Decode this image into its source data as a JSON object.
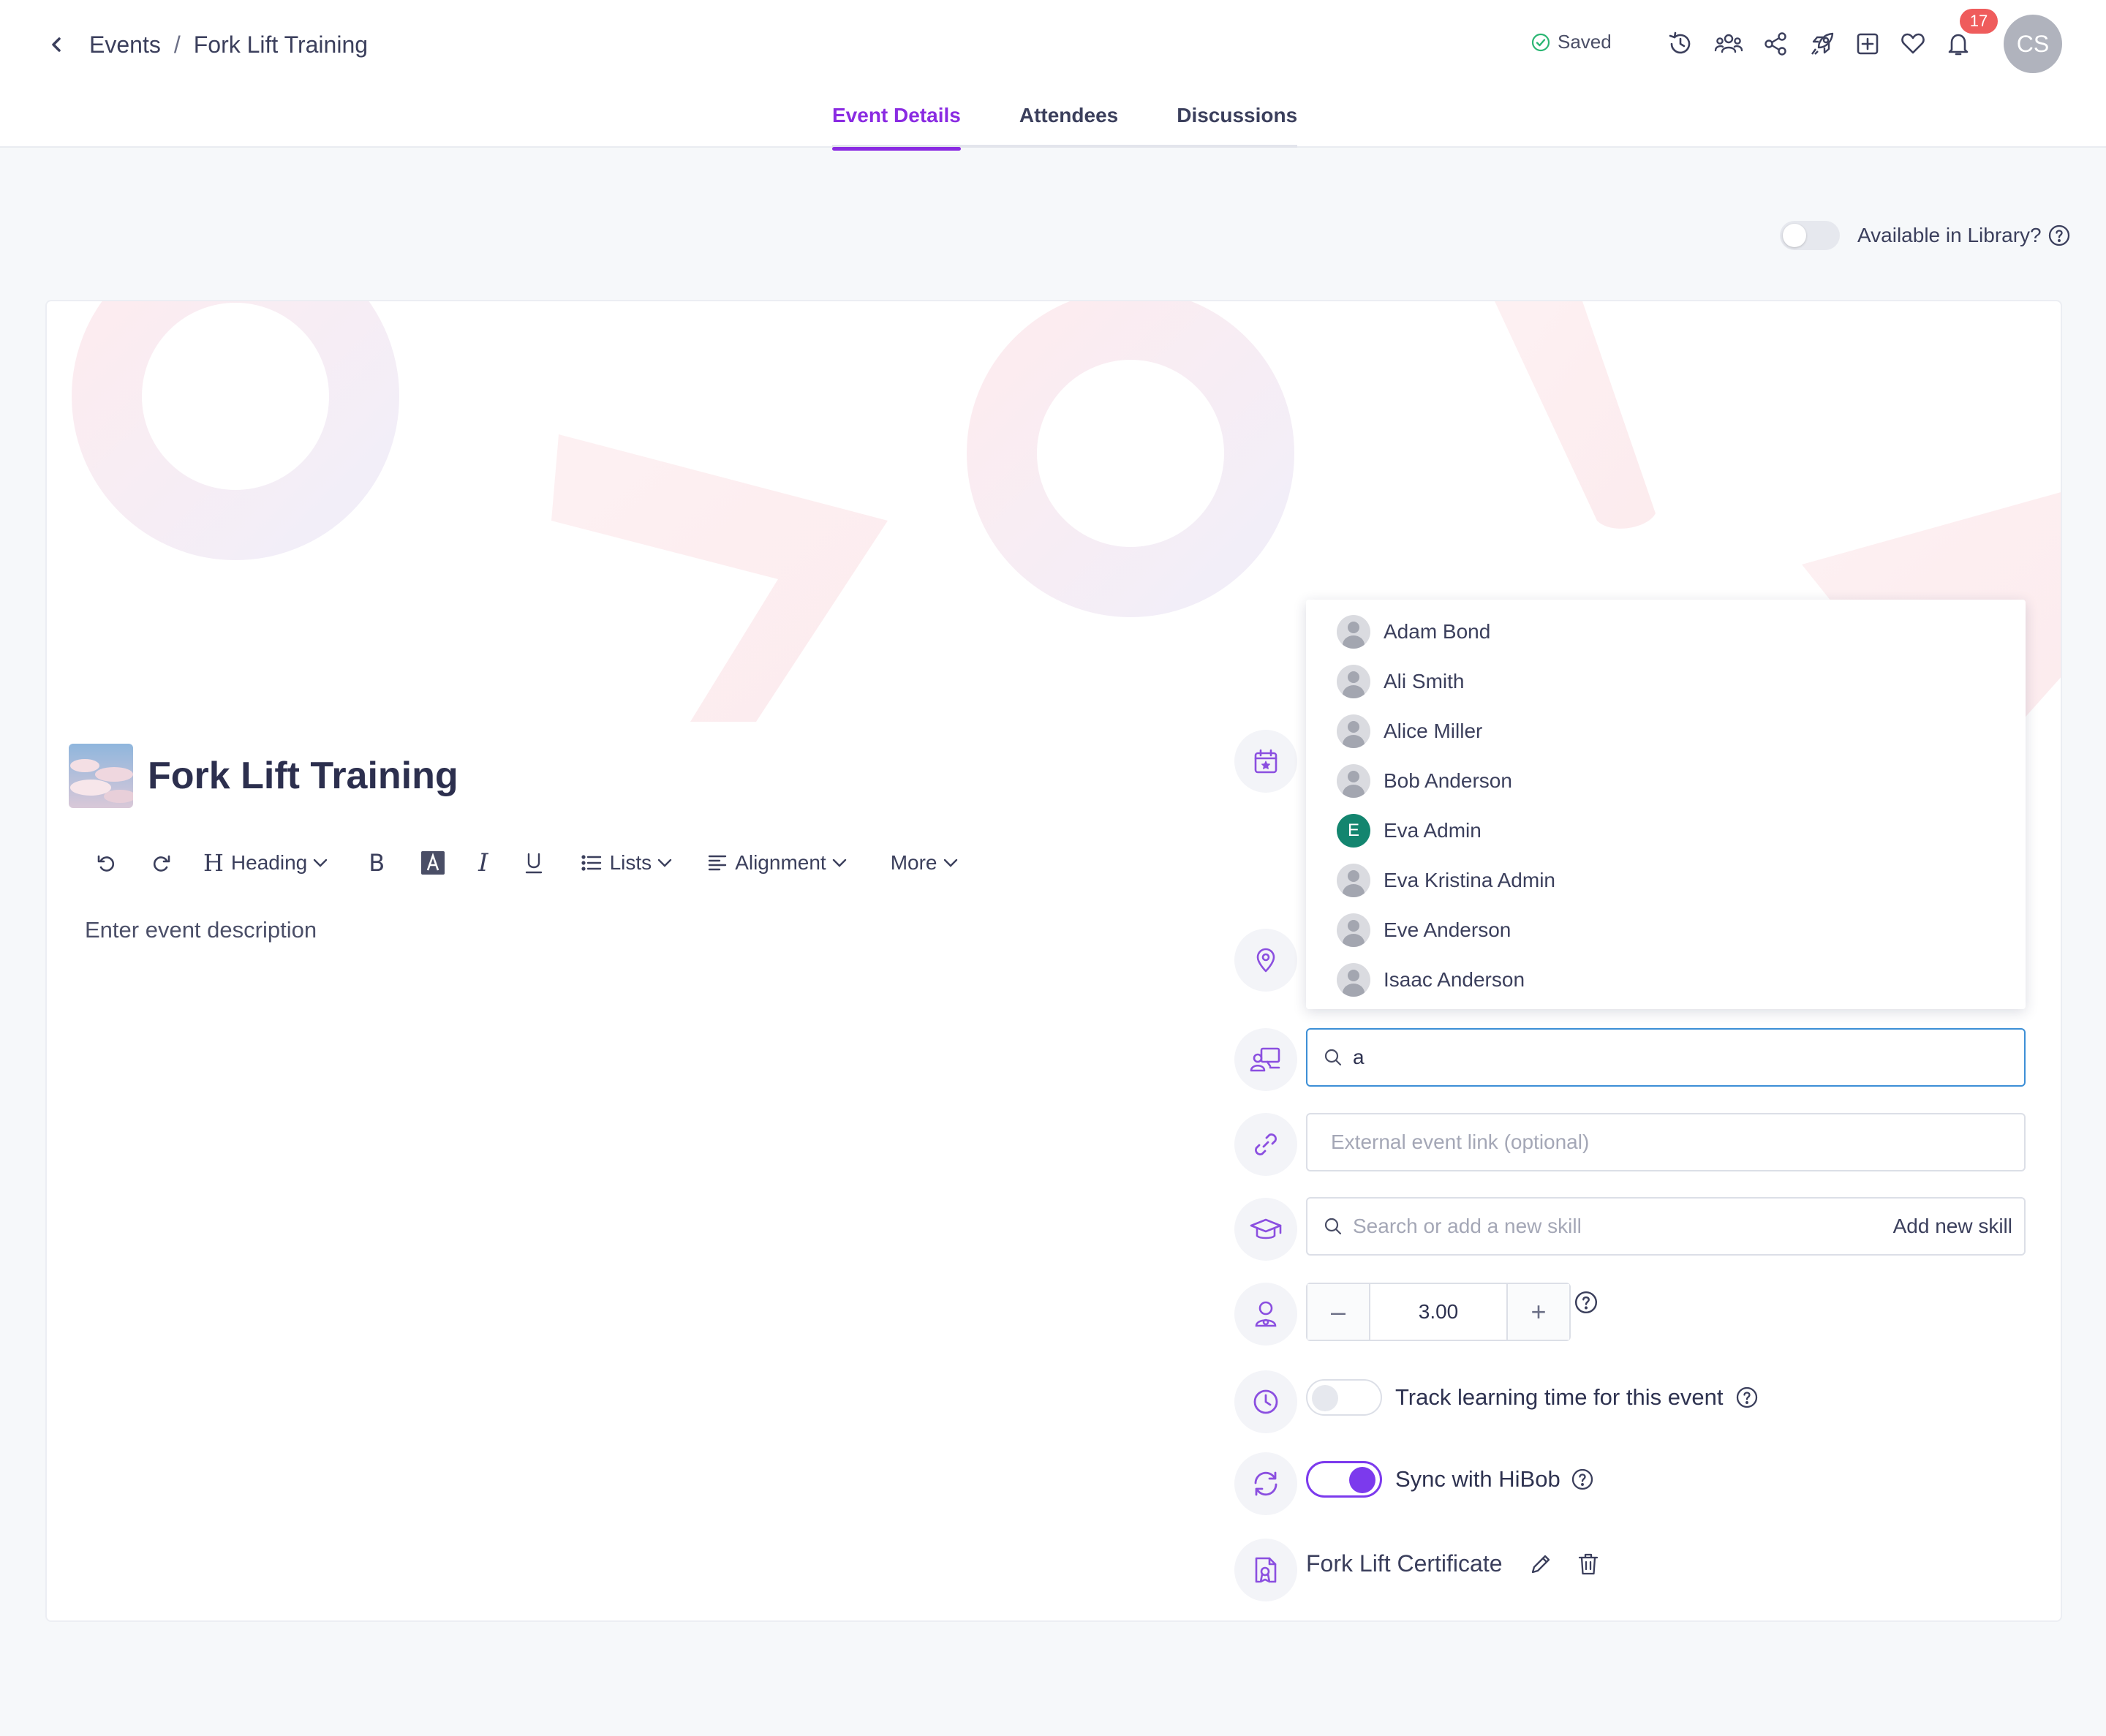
{
  "breadcrumb": {
    "parent": "Events",
    "separator": "/",
    "current": "Fork Lift Training"
  },
  "header": {
    "saved_label": "Saved",
    "notifications_count": "17",
    "avatar_initials": "CS",
    "icons": [
      "history-icon",
      "users-icon",
      "share-icon",
      "rocket-icon",
      "add-square-icon",
      "heart-icon",
      "bell-icon"
    ]
  },
  "tabs": [
    {
      "label": "Event Details",
      "active": true
    },
    {
      "label": "Attendees",
      "active": false
    },
    {
      "label": "Discussions",
      "active": false
    }
  ],
  "library": {
    "label": "Available in Library?",
    "enabled": false
  },
  "event": {
    "title": "Fork Lift Training"
  },
  "toolbar": {
    "heading": "Heading",
    "lists": "Lists",
    "alignment": "Alignment",
    "more": "More"
  },
  "description": {
    "placeholder": "Enter event description"
  },
  "instructor_dropdown": {
    "items": [
      {
        "name": "Adam Bond",
        "avatar": "placeholder"
      },
      {
        "name": "Ali Smith",
        "avatar": "placeholder"
      },
      {
        "name": "Alice Miller",
        "avatar": "placeholder"
      },
      {
        "name": "Bob Anderson",
        "avatar": "placeholder"
      },
      {
        "name": "Eva Admin",
        "avatar": "letter",
        "initial": "E"
      },
      {
        "name": "Eva Kristina Admin",
        "avatar": "placeholder"
      },
      {
        "name": "Eve Anderson",
        "avatar": "placeholder"
      },
      {
        "name": "Isaac Anderson",
        "avatar": "placeholder"
      }
    ]
  },
  "instructor_search": {
    "value": "a"
  },
  "external_link": {
    "placeholder": "External event link (optional)"
  },
  "skills": {
    "placeholder": "Search or add a new skill",
    "add_label": "Add new skill"
  },
  "credits": {
    "value": "3.00",
    "minus": "–",
    "plus": "+"
  },
  "track_time": {
    "label": "Track learning time for this event",
    "enabled": false
  },
  "sync": {
    "label": "Sync with HiBob",
    "enabled": true
  },
  "certificate": {
    "name": "Fork Lift Certificate"
  },
  "colors": {
    "accent": "#8a2be2",
    "toggle_on": "#7c3aed",
    "badge": "#ef5c5c",
    "saved_check": "#2bb673",
    "focus": "#3d8fd6"
  }
}
